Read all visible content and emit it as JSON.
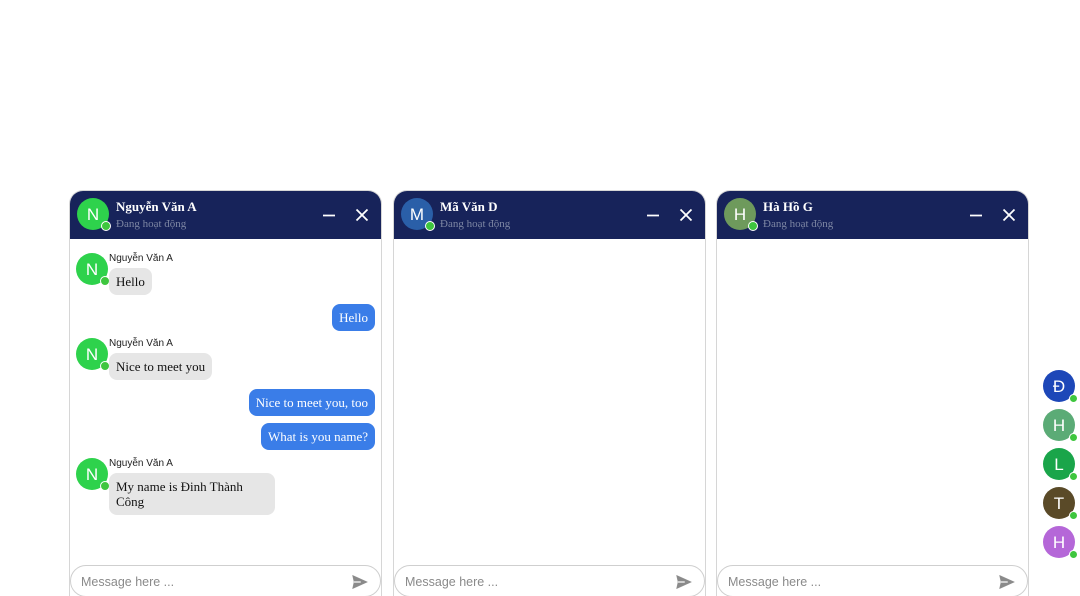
{
  "colors": {
    "header_bg": "#17235a",
    "sent_bubble": "#3a7de8",
    "received_bubble": "#e6e6e6",
    "online": "#3ec63e"
  },
  "icons": {
    "minimize": "minimize-icon",
    "close": "close-icon",
    "send": "send-icon"
  },
  "chats": [
    {
      "name": "Nguyễn Văn A",
      "status": "Đang hoạt động",
      "avatar_letter": "N",
      "avatar_color": "#2ed24c",
      "input_placeholder": "Message here ...",
      "messages": [
        {
          "from": "them",
          "sender": "Nguyễn Văn A",
          "text": "Hello"
        },
        {
          "from": "me",
          "text": "Hello"
        },
        {
          "from": "them",
          "sender": "Nguyễn Văn A",
          "text": "Nice to meet you"
        },
        {
          "from": "me",
          "text": "Nice to meet you, too"
        },
        {
          "from": "me",
          "text": "What is you name?"
        },
        {
          "from": "them",
          "sender": "Nguyễn Văn A",
          "text_line1": "My name is Đinh Thành",
          "text_line2": "Công"
        }
      ]
    },
    {
      "name": "Mã Văn D",
      "status": "Đang hoạt động",
      "avatar_letter": "M",
      "avatar_color": "#2a5fa8",
      "input_placeholder": "Message here ...",
      "messages": []
    },
    {
      "name": "Hà Hồ G",
      "status": "Đang hoạt động",
      "avatar_letter": "H",
      "avatar_color": "#6e9a5c",
      "input_placeholder": "Message here ...",
      "messages": []
    }
  ],
  "side_contacts": [
    {
      "letter": "Đ",
      "color": "#1d47b8"
    },
    {
      "letter": "H",
      "color": "#5bab76"
    },
    {
      "letter": "L",
      "color": "#1aa54a"
    },
    {
      "letter": "T",
      "color": "#5a4a28"
    },
    {
      "letter": "H",
      "color": "#b567d8"
    }
  ]
}
